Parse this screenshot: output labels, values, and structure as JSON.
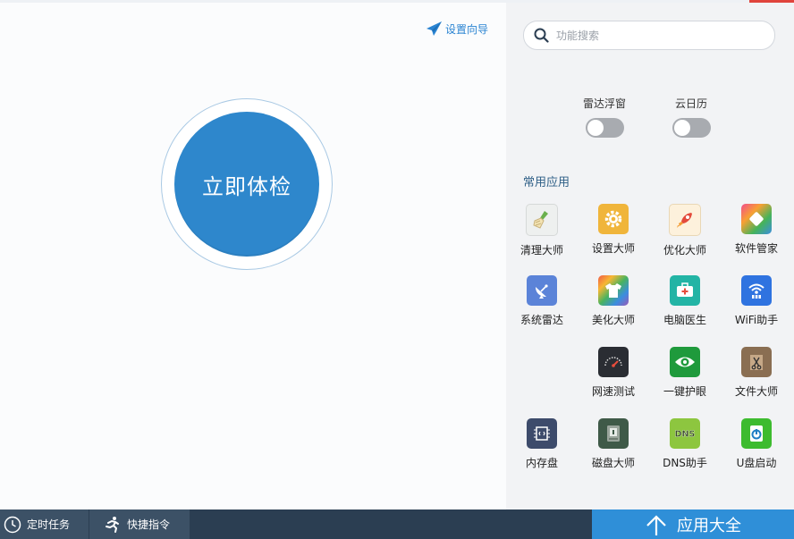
{
  "header": {
    "wizard_label": "设置向导"
  },
  "main": {
    "check_button_label": "立即体检"
  },
  "sidebar": {
    "search": {
      "placeholder": "功能搜索",
      "value": ""
    },
    "toggles": [
      {
        "label": "雷达浮窗",
        "on": false
      },
      {
        "label": "云日历",
        "on": false
      }
    ],
    "section_title": "常用应用",
    "apps": [
      {
        "label": "清理大师",
        "icon": "broom-icon"
      },
      {
        "label": "设置大师",
        "icon": "gear-icon"
      },
      {
        "label": "优化大师",
        "icon": "rocket-icon"
      },
      {
        "label": "软件管家",
        "icon": "software-box-icon"
      },
      {
        "label": "系统雷达",
        "icon": "radar-dish-icon"
      },
      {
        "label": "美化大师",
        "icon": "tshirt-icon"
      },
      {
        "label": "电脑医生",
        "icon": "medical-kit-icon"
      },
      {
        "label": "WiFi助手",
        "icon": "wifi-icon"
      },
      {
        "label": "网速测试",
        "icon": "speedometer-icon"
      },
      {
        "label": "一键护眼",
        "icon": "eye-icon"
      },
      {
        "label": "文件大师",
        "icon": "file-scissors-icon"
      },
      {
        "label": "内存盘",
        "icon": "memory-chip-icon"
      },
      {
        "label": "磁盘大师",
        "icon": "disk-icon"
      },
      {
        "label": "DNS助手",
        "icon": "dns-icon"
      },
      {
        "label": "U盘启动",
        "icon": "usb-power-icon"
      }
    ]
  },
  "bottom_bar": {
    "scheduled_task_label": "定时任务",
    "shortcut_label": "快捷指令",
    "all_apps_label": "应用大全"
  },
  "colors": {
    "accent": "#2e87cc",
    "bottom_bar": "#2b3e52",
    "all_apps": "#2f8fd8"
  }
}
